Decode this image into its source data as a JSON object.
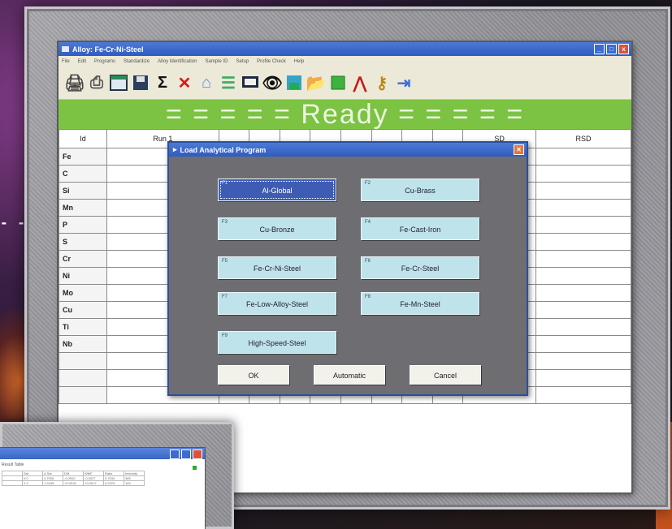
{
  "app": {
    "title": "Alloy: Fe-Cr-Ni-Steel",
    "menu": [
      "File",
      "Edit",
      "Programs",
      "Standardize",
      "Alloy Identification",
      "Sample ID",
      "Setup",
      "Profile Check",
      "Help"
    ],
    "window_buttons": [
      "_",
      "□",
      "x"
    ],
    "status": "= = = = = Ready = = = = ="
  },
  "grid": {
    "columns": [
      "Id",
      "Run 1",
      "",
      "",
      "",
      "",
      "",
      "",
      "",
      "",
      "SD",
      "RSD"
    ],
    "rows": [
      "Fe",
      "C",
      "Si",
      "Mn",
      "P",
      "S",
      "Cr",
      "Ni",
      "Mo",
      "Cu",
      "Ti",
      "Nb",
      "",
      "",
      ""
    ]
  },
  "dialog": {
    "title": "Load Analytical Program",
    "programs": [
      {
        "key": "F1",
        "label": "Al-Global",
        "selected": true
      },
      {
        "key": "F2",
        "label": "Cu-Brass",
        "selected": false
      },
      {
        "key": "F3",
        "label": "Cu-Bronze",
        "selected": false
      },
      {
        "key": "F4",
        "label": "Fe-Cast-Iron",
        "selected": false
      },
      {
        "key": "F5",
        "label": "Fe-Cr-Ni-Steel",
        "selected": false
      },
      {
        "key": "F6",
        "label": "Fe-Cr-Steel",
        "selected": false
      },
      {
        "key": "F7",
        "label": "Fe-Low-Alloy-Steel",
        "selected": false
      },
      {
        "key": "F8",
        "label": "Fe-Mn-Steel",
        "selected": false
      },
      {
        "key": "F9",
        "label": "High-Speed-Steel",
        "selected": false
      }
    ],
    "ok": "OK",
    "automatic": "Automatic",
    "cancel": "Cancel"
  },
  "toolbar_icons": [
    "printer-icon",
    "print-preview-icon",
    "window-icon",
    "save-icon",
    "sigma-icon",
    "delete-x-icon",
    "home-icon",
    "list-icon",
    "monitor-icon",
    "binoculars-icon",
    "disk-icon",
    "folder-open-icon",
    "green-square-icon",
    "spectrum-icon",
    "key-icon",
    "exit-door-icon"
  ],
  "secondary_window": {
    "label": "Result Table",
    "headers": [
      "",
      "Sat",
      "Δ Sat",
      "Diff",
      "WMF",
      "Ratio",
      "Intensity"
    ],
    "row1": [
      "",
      "0.0",
      "4.7000",
      "-0.0092",
      "-0.0027",
      "0.7034",
      "365"
    ],
    "row2": [
      "",
      "1.2",
      "1.2445",
      "+0.0016",
      "+0.0017",
      "0.2223",
      "164"
    ]
  }
}
